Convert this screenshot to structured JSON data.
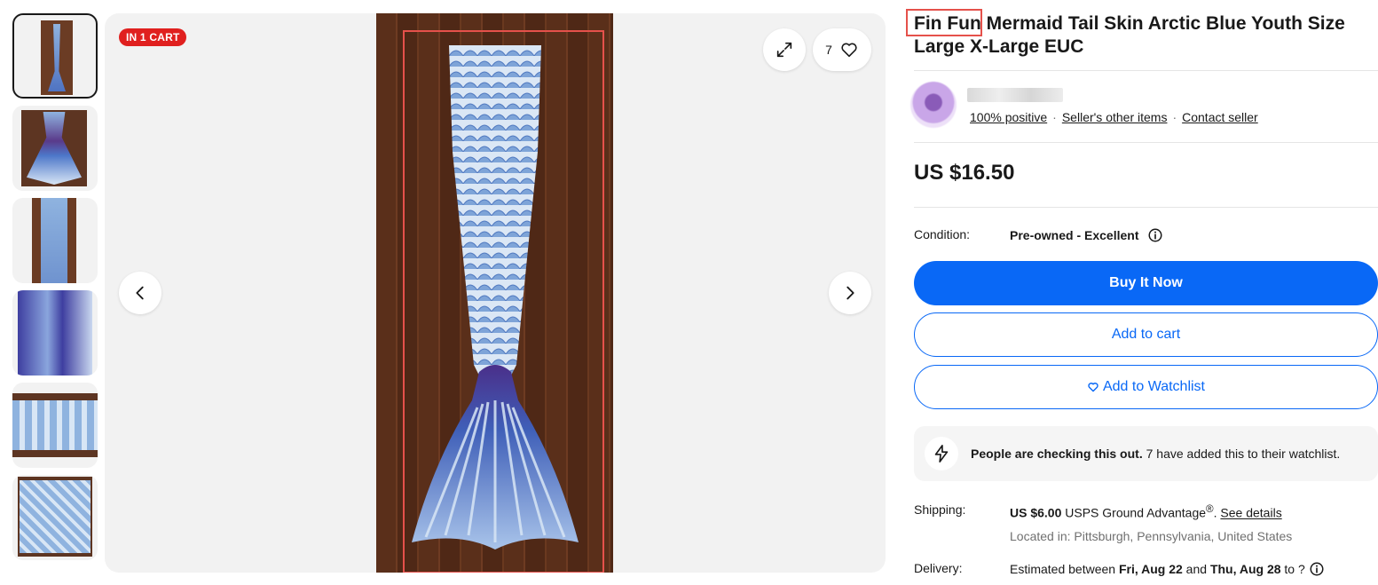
{
  "gallery": {
    "badge": "IN 1 CART",
    "watch_count": "7",
    "thumbnails": [
      "thumb-1",
      "thumb-2",
      "thumb-3",
      "thumb-4",
      "thumb-5",
      "thumb-6"
    ]
  },
  "listing": {
    "title_brand": "Fin Fun",
    "title_rest": " Mermaid Tail Skin Arctic Blue Youth Size Large X-Large EUC"
  },
  "seller": {
    "positive": "100% positive",
    "other_items": "Seller's other items",
    "contact": "Contact seller"
  },
  "price": "US $16.50",
  "condition": {
    "label": "Condition:",
    "value": "Pre-owned - Excellent"
  },
  "buttons": {
    "buy_now": "Buy It Now",
    "add_to_cart": "Add to cart",
    "add_to_watchlist": "Add to Watchlist"
  },
  "notice": {
    "bold": "People are checking this out.",
    "rest": " 7 have added this to their watchlist."
  },
  "shipping": {
    "label": "Shipping:",
    "cost": "US $6.00",
    "service": " USPS Ground Advantage",
    "reg_mark": "®",
    "see_details": "See details",
    "location": "Located in: Pittsburgh, Pennsylvania, United States"
  },
  "delivery": {
    "label": "Delivery:",
    "prefix": "Estimated between ",
    "start": "Fri, Aug 22",
    "and": " and ",
    "end": "Thu, Aug 28",
    "suffix": " to ?"
  },
  "colors": {
    "accent": "#0968f6",
    "badge_red": "#e0201f",
    "highlight": "#e5514b"
  }
}
